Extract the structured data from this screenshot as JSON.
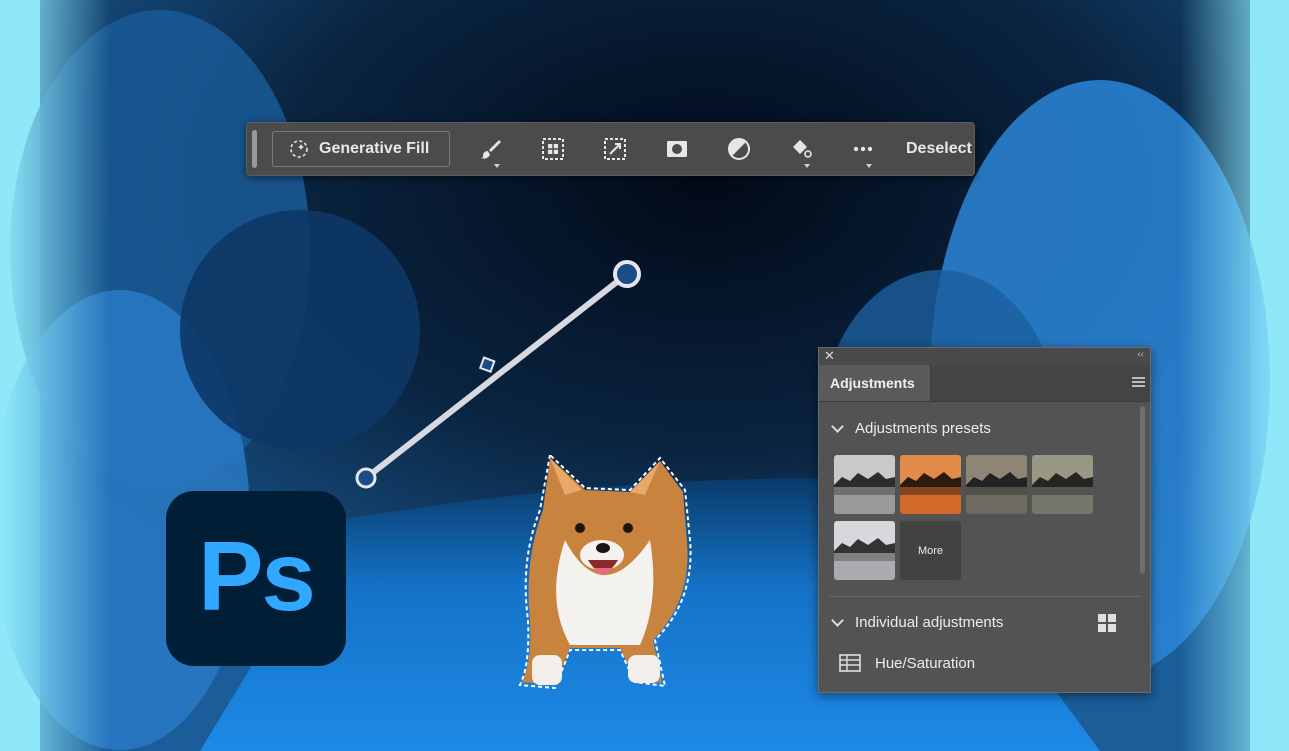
{
  "toolbar": {
    "generative_fill_label": "Generative Fill",
    "deselect_label": "Deselect",
    "tools": [
      "brush-icon",
      "expand-selection-icon",
      "transform-selection-icon",
      "mask-icon",
      "adjustment-icon",
      "fill-icon",
      "more-icon"
    ]
  },
  "logo": {
    "text": "Ps"
  },
  "panel": {
    "tab_label": "Adjustments",
    "presets_header": "Adjustments presets",
    "more_label": "More",
    "individual_header": "Individual adjustments",
    "hue_saturation_label": "Hue/Saturation"
  },
  "colors": {
    "background": "#8ee8f8",
    "ps_blue": "#31a8ff",
    "ps_dark": "#001e36",
    "panel_bg": "#535353",
    "toolbar_bg": "#4b4b4b"
  }
}
